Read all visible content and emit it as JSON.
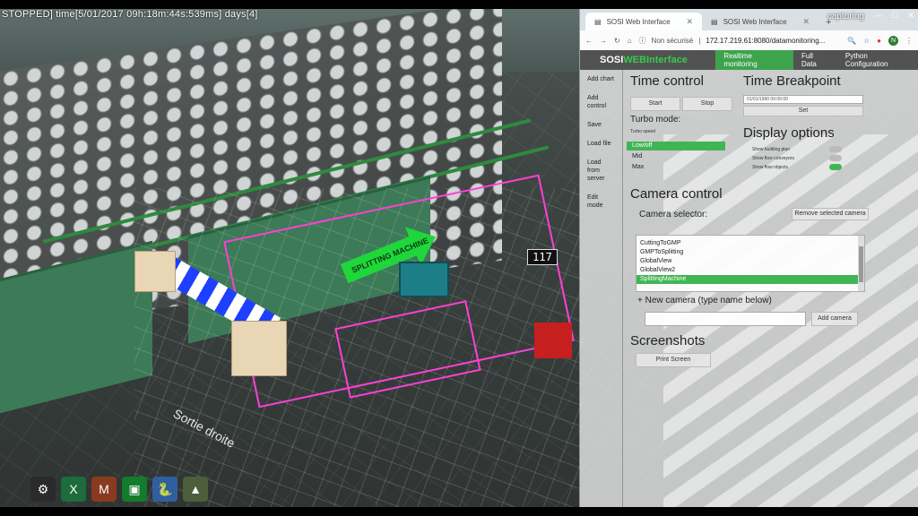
{
  "status_text": "STOPPED] time[5/01/2017   09h:18m:44s:539ms] days[4]",
  "scene": {
    "splitting_sign": "117",
    "floor_text": "Sortie droite",
    "machine_label": "SPLITTING MACHINE"
  },
  "browser": {
    "tabs": [
      {
        "label": "SOSI Web Interface",
        "active": true
      },
      {
        "label": "SOSI Web Interface",
        "active": false
      }
    ],
    "new_tab_symbol": "+",
    "capturing": "capturing",
    "security": "Non sécurisé",
    "url": "172.17.219.61:8080/datamonitoring...",
    "profile_initial": "N"
  },
  "app": {
    "logo_prefix": "SOSI",
    "logo_web": "WEB",
    "logo_suffix": "Interface",
    "nav": [
      {
        "label": "Realtime monitoring",
        "active": true
      },
      {
        "label": "Full Data",
        "active": false
      },
      {
        "label": "Python Configuration",
        "active": false
      }
    ],
    "sidebar": [
      "Add chart",
      "Add control",
      "Save",
      "Load file",
      "Load from server",
      "Edit mode"
    ],
    "time_control": {
      "title": "Time control",
      "start": "Start",
      "stop": "Stop",
      "turbo_title": "Turbo mode:",
      "turbo_caption": "Turbo speed",
      "turbo_options": [
        {
          "label": "Low/off",
          "selected": true
        },
        {
          "label": "Mid",
          "selected": false
        },
        {
          "label": "Max",
          "selected": false
        }
      ]
    },
    "time_breakpoint": {
      "title": "Time Breakpoint",
      "value": "01/01/1990 00:00:00",
      "set": "Set"
    },
    "display_options": {
      "title": "Display options",
      "items": [
        "Show building plan",
        "Show flow conveyors",
        "Show flow objects"
      ]
    },
    "camera_control": {
      "title": "Camera control",
      "selector_label": "Camera selector:",
      "remove_button": "Remove selected camera",
      "cameras": [
        {
          "name": "CuttingToGMP",
          "selected": false
        },
        {
          "name": "GMPToSplitting",
          "selected": false
        },
        {
          "name": "GlobalView",
          "selected": false
        },
        {
          "name": "GlobalView2",
          "selected": false
        },
        {
          "name": "SplittingMachine",
          "selected": true
        }
      ],
      "new_camera_label": "+ New camera (type name below)",
      "add_camera": "Add camera"
    },
    "screenshots": {
      "title": "Screenshots",
      "print_screen": "Print Screen"
    }
  }
}
